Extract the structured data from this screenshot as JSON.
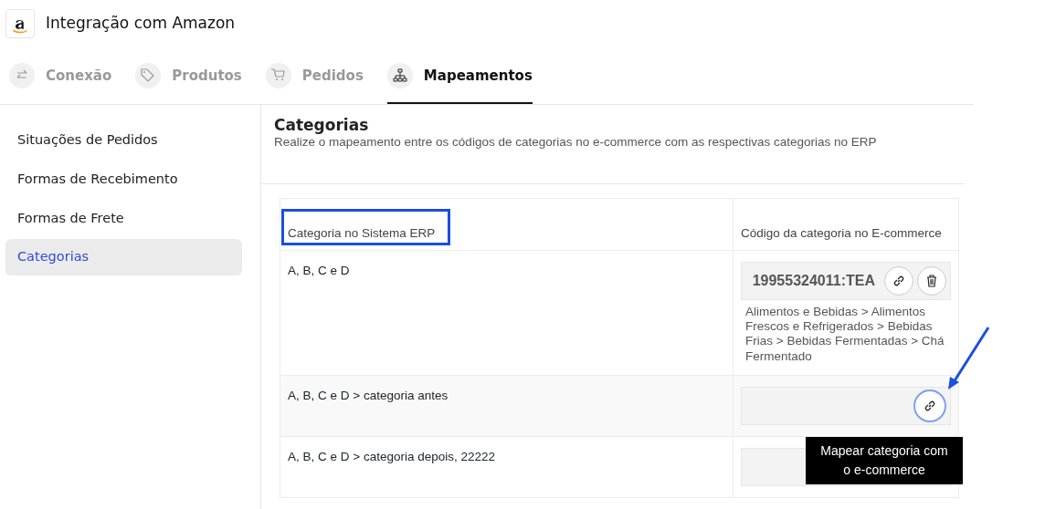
{
  "header": {
    "title": "Integração com Amazon"
  },
  "tabs": [
    {
      "label": "Conexão",
      "selected": false
    },
    {
      "label": "Produtos",
      "selected": false
    },
    {
      "label": "Pedidos",
      "selected": false
    },
    {
      "label": "Mapeamentos",
      "selected": true
    }
  ],
  "sidebar": {
    "items": [
      {
        "label": "Situações de Pedidos",
        "selected": false
      },
      {
        "label": "Formas de Recebimento",
        "selected": false
      },
      {
        "label": "Formas de Frete",
        "selected": false
      },
      {
        "label": "Categorias",
        "selected": true
      }
    ]
  },
  "section": {
    "title": "Categorias",
    "description": "Realize o mapeamento entre os códigos de categorias no e-commerce com as respectivas categorias no ERP"
  },
  "table": {
    "columns": [
      {
        "label": "Categoria no Sistema ERP",
        "highlighted": true
      },
      {
        "label": "Código da categoria no E-commerce",
        "highlighted": false
      }
    ],
    "rows": [
      {
        "category": "A, B, C e D",
        "code": "19955324011:TEA",
        "path": "Alimentos e Bebidas > Alimentos Frescos e Refrigerados > Bebidas Frias > Bebidas Fermentadas > Chá Fermentado"
      },
      {
        "category": "A, B, C e D > categoria antes",
        "tooltip": "Mapear categoria com o e-commerce"
      },
      {
        "category": "A, B, C e D > categoria depois, 22222"
      }
    ]
  }
}
